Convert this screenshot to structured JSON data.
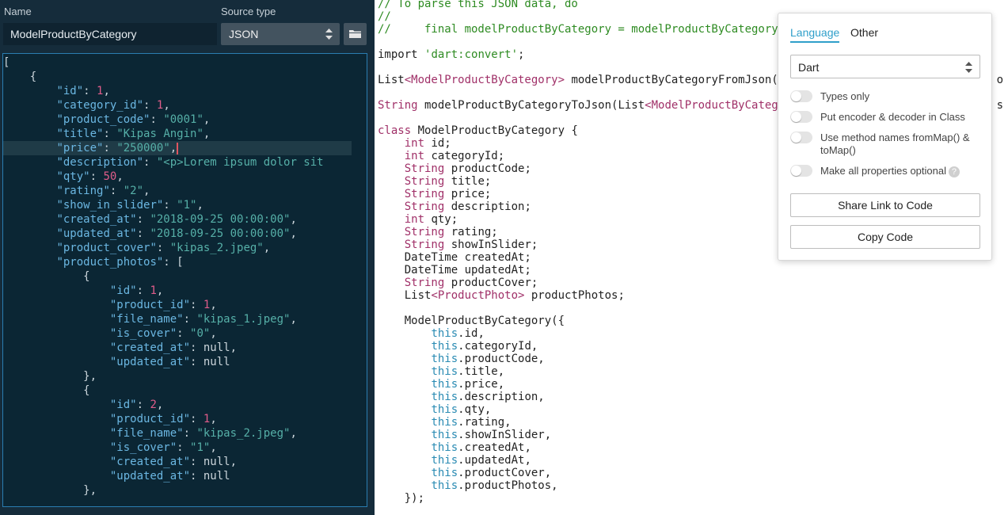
{
  "left_panel": {
    "name_label": "Name",
    "name_value": "ModelProductByCategory",
    "source_label": "Source type",
    "source_value": "JSON",
    "json_lines": [
      {
        "pre": "[",
        "k": "",
        "mid": "",
        "v": "",
        "vt": "",
        "post": ""
      },
      {
        "pre": "    {",
        "k": "",
        "mid": "",
        "v": "",
        "vt": "",
        "post": ""
      },
      {
        "pre": "        ",
        "k": "\"id\"",
        "mid": ": ",
        "v": "1",
        "vt": "n",
        "post": ","
      },
      {
        "pre": "        ",
        "k": "\"category_id\"",
        "mid": ": ",
        "v": "1",
        "vt": "n",
        "post": ","
      },
      {
        "pre": "        ",
        "k": "\"product_code\"",
        "mid": ": ",
        "v": "\"0001\"",
        "vt": "s",
        "post": ","
      },
      {
        "pre": "        ",
        "k": "\"title\"",
        "mid": ": ",
        "v": "\"Kipas Angin\"",
        "vt": "s",
        "post": ","
      },
      {
        "pre": "        ",
        "k": "\"price\"",
        "mid": ": ",
        "v": "\"250000\"",
        "vt": "s",
        "post": ","
      },
      {
        "pre": "        ",
        "k": "\"description\"",
        "mid": ": ",
        "v": "\"<p>Lorem ipsum dolor sit",
        "vt": "s",
        "post": ""
      },
      {
        "pre": "        ",
        "k": "\"qty\"",
        "mid": ": ",
        "v": "50",
        "vt": "n",
        "post": ","
      },
      {
        "pre": "        ",
        "k": "\"rating\"",
        "mid": ": ",
        "v": "\"2\"",
        "vt": "s",
        "post": ","
      },
      {
        "pre": "        ",
        "k": "\"show_in_slider\"",
        "mid": ": ",
        "v": "\"1\"",
        "vt": "s",
        "post": ","
      },
      {
        "pre": "        ",
        "k": "\"created_at\"",
        "mid": ": ",
        "v": "\"2018-09-25 00:00:00\"",
        "vt": "s",
        "post": ","
      },
      {
        "pre": "        ",
        "k": "\"updated_at\"",
        "mid": ": ",
        "v": "\"2018-09-25 00:00:00\"",
        "vt": "s",
        "post": ","
      },
      {
        "pre": "        ",
        "k": "\"product_cover\"",
        "mid": ": ",
        "v": "\"kipas_2.jpeg\"",
        "vt": "s",
        "post": ","
      },
      {
        "pre": "        ",
        "k": "\"product_photos\"",
        "mid": ": [",
        "v": "",
        "vt": "",
        "post": ""
      },
      {
        "pre": "            {",
        "k": "",
        "mid": "",
        "v": "",
        "vt": "",
        "post": ""
      },
      {
        "pre": "                ",
        "k": "\"id\"",
        "mid": ": ",
        "v": "1",
        "vt": "n",
        "post": ","
      },
      {
        "pre": "                ",
        "k": "\"product_id\"",
        "mid": ": ",
        "v": "1",
        "vt": "n",
        "post": ","
      },
      {
        "pre": "                ",
        "k": "\"file_name\"",
        "mid": ": ",
        "v": "\"kipas_1.jpeg\"",
        "vt": "s",
        "post": ","
      },
      {
        "pre": "                ",
        "k": "\"is_cover\"",
        "mid": ": ",
        "v": "\"0\"",
        "vt": "s",
        "post": ","
      },
      {
        "pre": "                ",
        "k": "\"created_at\"",
        "mid": ": ",
        "v": "null",
        "vt": "nl",
        "post": ","
      },
      {
        "pre": "                ",
        "k": "\"updated_at\"",
        "mid": ": ",
        "v": "null",
        "vt": "nl",
        "post": ""
      },
      {
        "pre": "            },",
        "k": "",
        "mid": "",
        "v": "",
        "vt": "",
        "post": ""
      },
      {
        "pre": "            {",
        "k": "",
        "mid": "",
        "v": "",
        "vt": "",
        "post": ""
      },
      {
        "pre": "                ",
        "k": "\"id\"",
        "mid": ": ",
        "v": "2",
        "vt": "n",
        "post": ","
      },
      {
        "pre": "                ",
        "k": "\"product_id\"",
        "mid": ": ",
        "v": "1",
        "vt": "n",
        "post": ","
      },
      {
        "pre": "                ",
        "k": "\"file_name\"",
        "mid": ": ",
        "v": "\"kipas_2.jpeg\"",
        "vt": "s",
        "post": ","
      },
      {
        "pre": "                ",
        "k": "\"is_cover\"",
        "mid": ": ",
        "v": "\"1\"",
        "vt": "s",
        "post": ","
      },
      {
        "pre": "                ",
        "k": "\"created_at\"",
        "mid": ": ",
        "v": "null",
        "vt": "nl",
        "post": ","
      },
      {
        "pre": "                ",
        "k": "\"updated_at\"",
        "mid": ": ",
        "v": "null",
        "vt": "nl",
        "post": ""
      },
      {
        "pre": "            },",
        "k": "",
        "mid": "",
        "v": "",
        "vt": "",
        "post": ""
      }
    ]
  },
  "code_lines": [
    [
      [
        "// To parse this JSON data, do",
        "cm"
      ]
    ],
    [
      [
        "//",
        "cm"
      ]
    ],
    [
      [
        "//     final modelProductByCategory = modelProductByCategory",
        "cm"
      ]
    ],
    [],
    [
      [
        "import ",
        ""
      ],
      [
        "'dart:convert'",
        "ds"
      ],
      [
        ";",
        ""
      ]
    ],
    [],
    [
      [
        "List",
        ""
      ],
      [
        "<ModelProductByCategory>",
        "ty"
      ],
      [
        " modelProductByCategoryFromJson(",
        ""
      ]
    ],
    [],
    [
      [
        "String",
        "dk"
      ],
      [
        " modelProductByCategoryToJson(List",
        ""
      ],
      [
        "<ModelProductByCateg",
        "ty"
      ]
    ],
    [],
    [
      [
        "class",
        "dk"
      ],
      [
        " ModelProductByCategory {",
        ""
      ]
    ],
    [
      [
        "    ",
        ""
      ],
      [
        "int",
        "dk"
      ],
      [
        " id;",
        ""
      ]
    ],
    [
      [
        "    ",
        ""
      ],
      [
        "int",
        "dk"
      ],
      [
        " categoryId;",
        ""
      ]
    ],
    [
      [
        "    ",
        ""
      ],
      [
        "String",
        "dk"
      ],
      [
        " productCode;",
        ""
      ]
    ],
    [
      [
        "    ",
        ""
      ],
      [
        "String",
        "dk"
      ],
      [
        " title;",
        ""
      ]
    ],
    [
      [
        "    ",
        ""
      ],
      [
        "String",
        "dk"
      ],
      [
        " price;",
        ""
      ]
    ],
    [
      [
        "    ",
        ""
      ],
      [
        "String",
        "dk"
      ],
      [
        " description;",
        ""
      ]
    ],
    [
      [
        "    ",
        ""
      ],
      [
        "int",
        "dk"
      ],
      [
        " qty;",
        ""
      ]
    ],
    [
      [
        "    ",
        ""
      ],
      [
        "String",
        "dk"
      ],
      [
        " rating;",
        ""
      ]
    ],
    [
      [
        "    ",
        ""
      ],
      [
        "String",
        "dk"
      ],
      [
        " showInSlider;",
        ""
      ]
    ],
    [
      [
        "    DateTime createdAt;",
        ""
      ]
    ],
    [
      [
        "    DateTime updatedAt;",
        ""
      ]
    ],
    [
      [
        "    ",
        ""
      ],
      [
        "String",
        "dk"
      ],
      [
        " productCover;",
        ""
      ]
    ],
    [
      [
        "    List",
        ""
      ],
      [
        "<ProductPhoto>",
        "ty"
      ],
      [
        " productPhotos;",
        ""
      ]
    ],
    [],
    [
      [
        "    ModelProductByCategory({",
        ""
      ]
    ],
    [
      [
        "        ",
        ""
      ],
      [
        "this",
        "th"
      ],
      [
        ".id,",
        ""
      ]
    ],
    [
      [
        "        ",
        ""
      ],
      [
        "this",
        "th"
      ],
      [
        ".categoryId,",
        ""
      ]
    ],
    [
      [
        "        ",
        ""
      ],
      [
        "this",
        "th"
      ],
      [
        ".productCode,",
        ""
      ]
    ],
    [
      [
        "        ",
        ""
      ],
      [
        "this",
        "th"
      ],
      [
        ".title,",
        ""
      ]
    ],
    [
      [
        "        ",
        ""
      ],
      [
        "this",
        "th"
      ],
      [
        ".price,",
        ""
      ]
    ],
    [
      [
        "        ",
        ""
      ],
      [
        "this",
        "th"
      ],
      [
        ".description,",
        ""
      ]
    ],
    [
      [
        "        ",
        ""
      ],
      [
        "this",
        "th"
      ],
      [
        ".qty,",
        ""
      ]
    ],
    [
      [
        "        ",
        ""
      ],
      [
        "this",
        "th"
      ],
      [
        ".rating,",
        ""
      ]
    ],
    [
      [
        "        ",
        ""
      ],
      [
        "this",
        "th"
      ],
      [
        ".showInSlider,",
        ""
      ]
    ],
    [
      [
        "        ",
        ""
      ],
      [
        "this",
        "th"
      ],
      [
        ".createdAt,",
        ""
      ]
    ],
    [
      [
        "        ",
        ""
      ],
      [
        "this",
        "th"
      ],
      [
        ".updatedAt,",
        ""
      ]
    ],
    [
      [
        "        ",
        ""
      ],
      [
        "this",
        "th"
      ],
      [
        ".productCover,",
        ""
      ]
    ],
    [
      [
        "        ",
        ""
      ],
      [
        "this",
        "th"
      ],
      [
        ".productPhotos,",
        ""
      ]
    ],
    [
      [
        "    });",
        ""
      ]
    ]
  ],
  "code_right_fragments": {
    "line7": "o",
    "line9": "s"
  },
  "options": {
    "tab_language": "Language",
    "tab_other": "Other",
    "language_value": "Dart",
    "toggles": [
      {
        "label": "Types only",
        "on": false
      },
      {
        "label": "Put encoder & decoder in Class",
        "on": false
      },
      {
        "label": "Use method names fromMap() & toMap()",
        "on": false
      },
      {
        "label": "Make all properties optional",
        "on": false,
        "help": "?"
      }
    ],
    "share_button": "Share Link to Code",
    "copy_button": "Copy Code"
  },
  "colors": {
    "accent": "#2f9fca",
    "editor_bg": "#0b2634",
    "panel_bg": "#152c3b"
  }
}
